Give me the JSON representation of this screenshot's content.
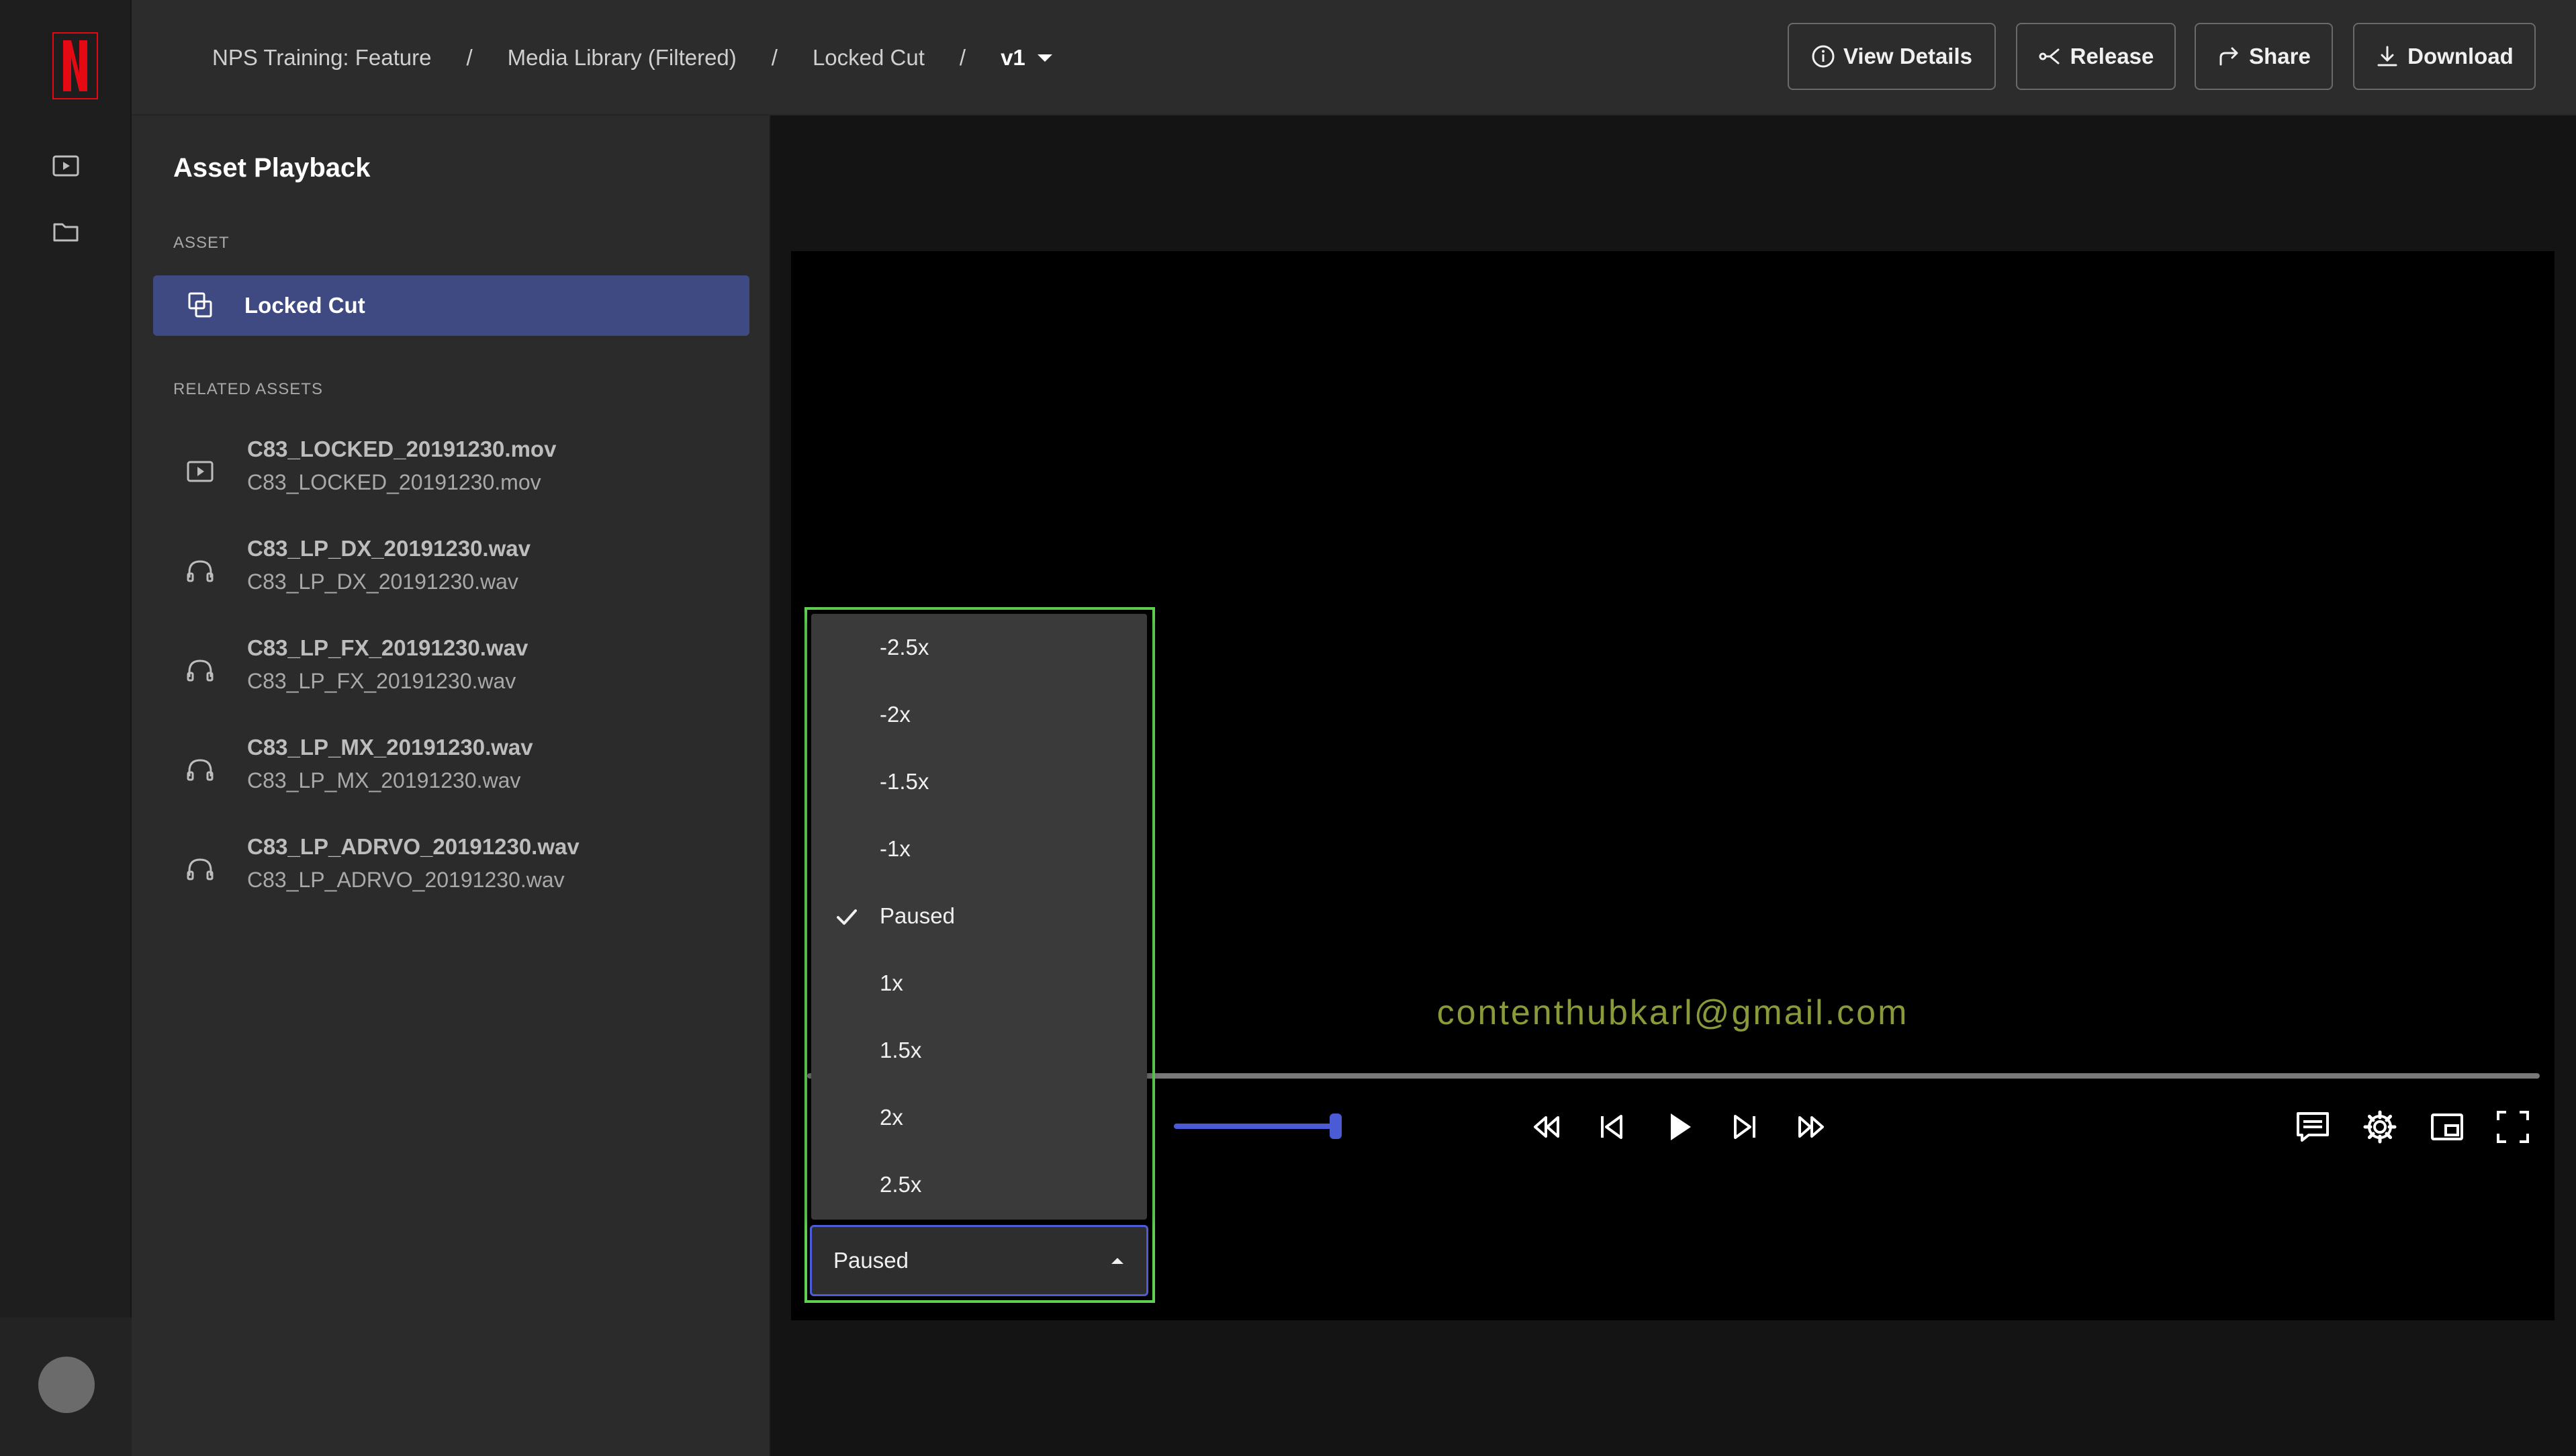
{
  "breadcrumb": {
    "items": [
      "NPS Training: Feature",
      "Media Library (Filtered)",
      "Locked Cut"
    ],
    "separator": "/",
    "version": "v1"
  },
  "header_actions": {
    "view_details": "View Details",
    "release": "Release",
    "share": "Share",
    "download": "Download"
  },
  "sidebar": {
    "title": "Asset Playback",
    "asset_section": "ASSET",
    "selected_asset": "Locked Cut",
    "related_section": "RELATED ASSETS",
    "related": [
      {
        "name": "C83_LOCKED_20191230.mov",
        "file": "C83_LOCKED_20191230.mov",
        "icon": "video-file-icon"
      },
      {
        "name": "C83_LP_DX_20191230.wav",
        "file": "C83_LP_DX_20191230.wav",
        "icon": "headphones-icon"
      },
      {
        "name": "C83_LP_FX_20191230.wav",
        "file": "C83_LP_FX_20191230.wav",
        "icon": "headphones-icon"
      },
      {
        "name": "C83_LP_MX_20191230.wav",
        "file": "C83_LP_MX_20191230.wav",
        "icon": "headphones-icon"
      },
      {
        "name": "C83_LP_ADRVO_20191230.wav",
        "file": "C83_LP_ADRVO_20191230.wav",
        "icon": "headphones-icon"
      }
    ]
  },
  "player": {
    "watermark": "contenthubkarl@gmail.com",
    "volume_level": 1.0,
    "speed_options": [
      "-2.5x",
      "-2x",
      "-1.5x",
      "-1x",
      "Paused",
      "1x",
      "1.5x",
      "2x",
      "2.5x"
    ],
    "speed_selected": "Paused"
  },
  "colors": {
    "brand_red": "#e50914",
    "accent_blue": "#4b5bd6",
    "selected_row": "#3f4a83",
    "highlight_green": "#5fd152",
    "watermark_olive": "#8a9a3a"
  }
}
